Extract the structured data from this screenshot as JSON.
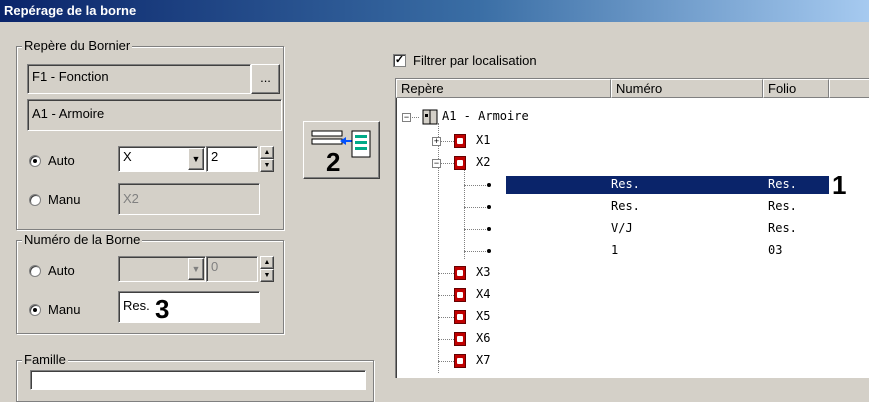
{
  "window": {
    "title": "Repérage de la borne"
  },
  "bornier": {
    "legend": "Repère du Bornier",
    "fonction": "F1 - Fonction",
    "browse_label": "...",
    "armoire": "A1 - Armoire",
    "auto_label": "Auto",
    "auto_select": "X",
    "auto_number": "2",
    "manu_label": "Manu",
    "manu_value": "X2",
    "mode": "Auto"
  },
  "borne": {
    "legend": "Numéro de la Borne",
    "auto_label": "Auto",
    "auto_number": "0",
    "manu_label": "Manu",
    "manu_value": "Res.",
    "mode": "Manu"
  },
  "famille": {
    "legend": "Famille"
  },
  "filter": {
    "label": "Filtrer par localisation",
    "checked": true
  },
  "tree": {
    "columns": [
      "Repère",
      "Numéro",
      "Folio"
    ],
    "root": "A1 - Armoire",
    "nodes": [
      "X1",
      "X2",
      "X3",
      "X4",
      "X5",
      "X6",
      "X7"
    ],
    "x2_rows": [
      {
        "numero": "Res.",
        "folio": "Res."
      },
      {
        "numero": "Res.",
        "folio": "Res."
      },
      {
        "numero": "V/J",
        "folio": "Res."
      },
      {
        "numero": "1",
        "folio": "03"
      }
    ]
  },
  "callouts": {
    "one": "1",
    "two": "2",
    "three": "3"
  },
  "colors": {
    "selection": "#0a246a",
    "title_start": "#0a246a",
    "title_end": "#a6caf0"
  }
}
